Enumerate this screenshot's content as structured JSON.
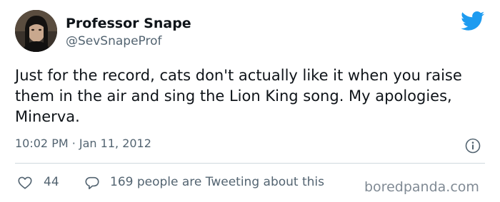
{
  "author": {
    "display_name": "Professor Snape",
    "handle": "@SevSnapeProf"
  },
  "tweet": {
    "text": "Just for the record, cats don't actually like it when you raise them in the air and sing the Lion King song. My apologies, Minerva.",
    "timestamp": "10:02 PM · Jan 11, 2012"
  },
  "footer": {
    "like_count": "44",
    "conversation_text": "169 people are Tweeting about this"
  },
  "watermark": "boredpanda.com",
  "colors": {
    "twitter_blue": "#1d9bf0",
    "secondary_text": "#536471",
    "primary_text": "#0f1419"
  },
  "icons": {
    "brand": "twitter-bird-icon",
    "info": "info-icon",
    "like": "heart-icon",
    "reply": "reply-icon"
  }
}
